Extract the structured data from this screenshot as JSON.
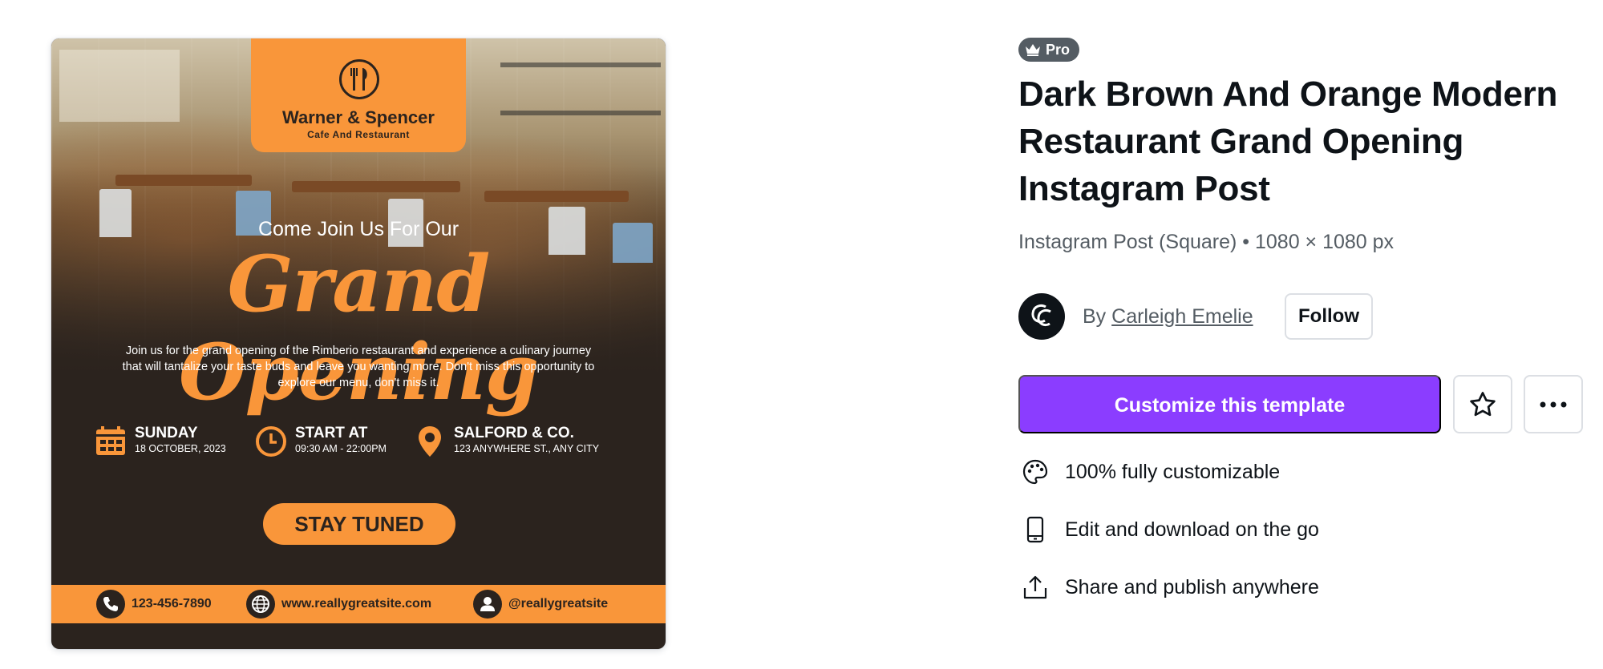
{
  "preview": {
    "logo_name": "Warner & Spencer",
    "logo_sub": "Cafe And Restaurant",
    "tagline": "Come Join Us For Our",
    "script_title": "Grand Opening",
    "blurb": "Join us for the grand opening of the Rimberio restaurant and experience a culinary journey that will tantalize your taste buds and leave you wanting more. Don't miss this opportunity to explore our menu, don't miss it.",
    "info": [
      {
        "title": "SUNDAY",
        "sub": "18 OCTOBER, 2023",
        "icon": "calendar-icon"
      },
      {
        "title": "START AT",
        "sub": "09:30 AM - 22:00PM",
        "icon": "clock-icon"
      },
      {
        "title": "SALFORD & CO.",
        "sub": "123 ANYWHERE ST., ANY CITY",
        "icon": "location-pin-icon"
      }
    ],
    "cta": "STAY TUNED",
    "contacts": [
      {
        "text": "123-456-7890",
        "icon": "phone-icon"
      },
      {
        "text": "www.reallygreatsite.com",
        "icon": "globe-icon"
      },
      {
        "text": "@reallygreatsite",
        "icon": "user-icon"
      }
    ],
    "colors": {
      "orange": "#f9963a",
      "dark_brown": "#2b231e"
    }
  },
  "details": {
    "badge": "Pro",
    "badge_icon": "crown-icon",
    "title": "Dark Brown And Orange Modern Restaurant Grand Opening Instagram Post",
    "subtitle": "Instagram Post (Square) • 1080 × 1080 px",
    "author_prefix": "By",
    "author_name": "Carleigh Emelie",
    "follow_label": "Follow",
    "customize_label": "Customize this template",
    "features": [
      {
        "text": "100% fully customizable",
        "icon": "palette-icon"
      },
      {
        "text": "Edit and download on the go",
        "icon": "mobile-icon"
      },
      {
        "text": "Share and publish anywhere",
        "icon": "share-icon"
      }
    ],
    "colors": {
      "primary": "#8b3dff",
      "text": "#0e1318",
      "muted": "#545c63"
    }
  }
}
